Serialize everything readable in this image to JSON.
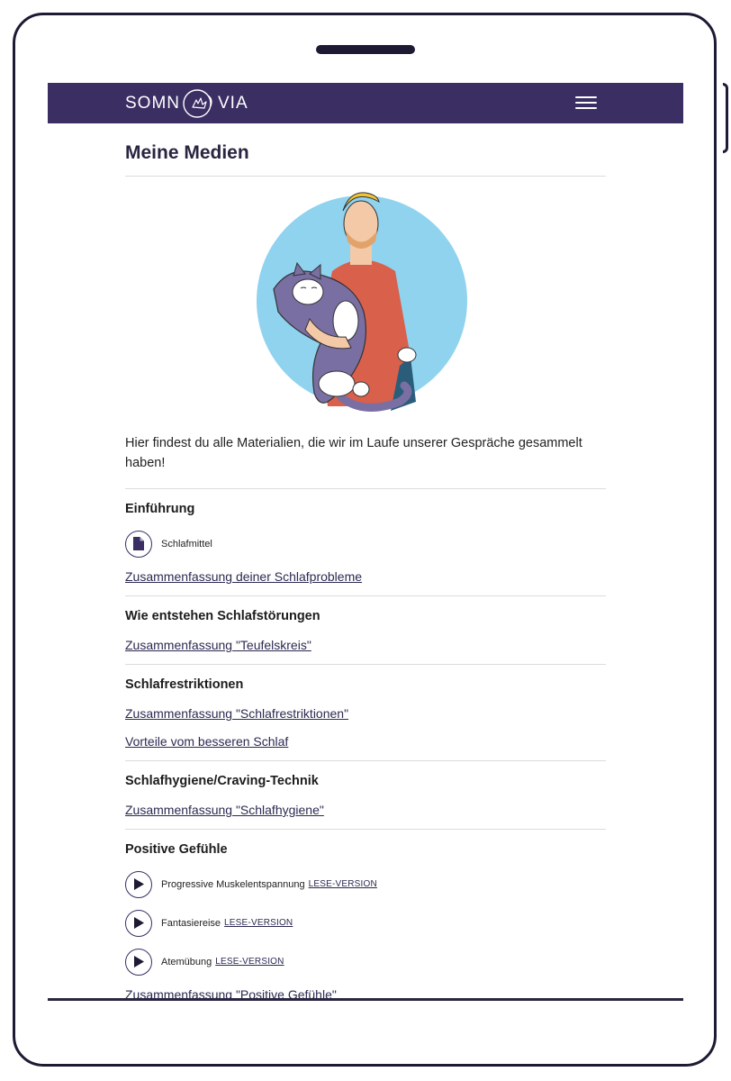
{
  "navbar": {
    "logo_left": "SOMN",
    "logo_right": "VIA",
    "menu_icon": "hamburger-menu-icon",
    "background": "#3a2e63"
  },
  "page": {
    "title": "Meine Medien",
    "intro": "Hier findest du alle Materialien, die wir im Laufe unserer Gespräche gesammelt haben!"
  },
  "sections": {
    "einfuehrung": {
      "title": "Einführung",
      "document_label": "Schlafmittel",
      "document_icon": "document-icon",
      "link1": "Zusammenfassung deiner Schlafprobleme"
    },
    "entstehen": {
      "title": "Wie entstehen Schlafstörungen",
      "link1": "Zusammenfassung \"Teufelskreis\""
    },
    "restriktionen": {
      "title": "Schlafrestriktionen",
      "link1": "Zusammenfassung \"Schlafrestriktionen\"",
      "link2": "Vorteile vom besseren Schlaf"
    },
    "hygiene": {
      "title": "Schlafhygiene/Craving-Technik",
      "link1": "Zusammenfassung \"Schlafhygiene\""
    },
    "positive": {
      "title": "Positive Gefühle",
      "play_icon": "play-icon",
      "items": [
        {
          "label": "Progressive Muskelentspannung",
          "read_link": "LESE-VERSION"
        },
        {
          "label": "Fantasiereise",
          "read_link": "LESE-VERSION"
        },
        {
          "label": "Atemübung",
          "read_link": "LESE-VERSION"
        }
      ],
      "link1": "Zusammenfassung \"Positive Gefühle\""
    }
  },
  "colors": {
    "brand": "#3a2e63",
    "link": "#2b2a52",
    "illustration_circle": "#8fd3ef"
  }
}
